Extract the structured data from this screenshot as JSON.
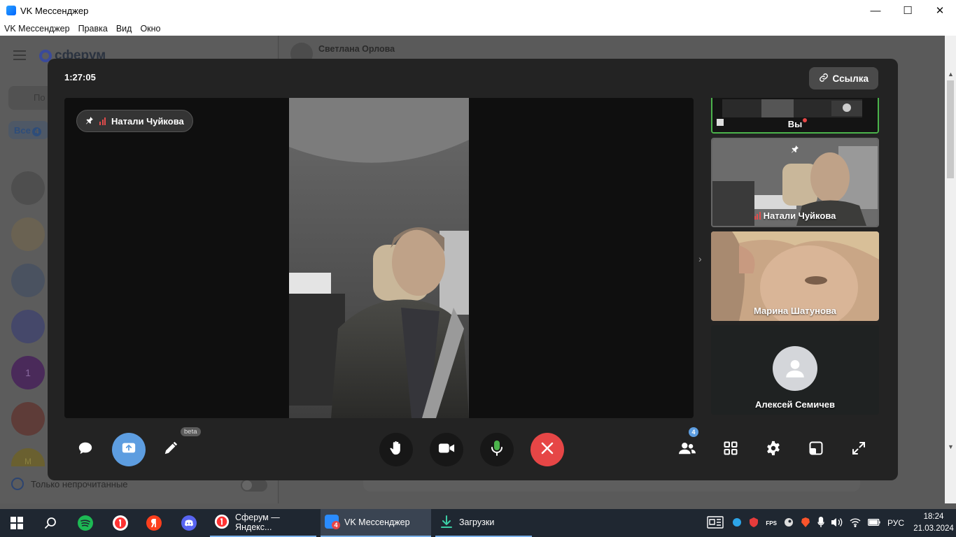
{
  "window": {
    "title": "VK Мессенджер"
  },
  "menu": [
    "VK Мессенджер",
    "Правка",
    "Вид",
    "Окно"
  ],
  "background": {
    "logo": "сферум",
    "search_placeholder": "По",
    "tab_all": "Все",
    "tab_all_count": "4",
    "contact_name": "Светлана Орлова",
    "unread_only": "Только непрочитанные",
    "avatar_letter": "1",
    "avatar_letter_2": "М"
  },
  "call": {
    "timer": "1:27:05",
    "link_label": "Ссылка",
    "pinned_name": "Натали Чуйкова",
    "participants_count": "4",
    "beta_label": "beta",
    "tiles": [
      {
        "name": "Вы"
      },
      {
        "name": "Натали Чуйкова"
      },
      {
        "name": "Марина Шатунова"
      },
      {
        "name": "Алексей Семичев"
      }
    ]
  },
  "taskbar": {
    "tasks": [
      {
        "label": "Сферум — Яндекс..."
      },
      {
        "label": "VK Мессенджер",
        "badge": "4"
      },
      {
        "label": "Загрузки"
      }
    ],
    "language": "РУС",
    "time": "18:24",
    "date": "21.03.2024"
  },
  "colors": {
    "accent": "#5d9de0",
    "end_call": "#e64646",
    "speaking": "#4bb34b",
    "signal": "#e24c4c"
  }
}
